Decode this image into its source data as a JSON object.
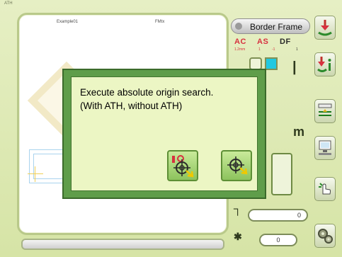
{
  "window": {
    "corner_tag": "ATH"
  },
  "canvas": {
    "title_left": "Example01",
    "title_right": "FMtx"
  },
  "right_panel": {
    "frame_button_label": "Border Frame",
    "code_labels": [
      "AC",
      "AS",
      "DF"
    ],
    "code_sub_labels": [
      "1.2mm",
      "1",
      "-1",
      "1"
    ],
    "letter_m": "m",
    "counter_1": "0",
    "counter_2": "0"
  },
  "dialog": {
    "message_line1": "Execute absolute origin search.",
    "message_line2": "(With ATH, without ATH)",
    "buttons": [
      {
        "name": "with-ath-origin-search-icon"
      },
      {
        "name": "without-ath-origin-search-icon"
      }
    ]
  },
  "colors": {
    "background": "#dde9b8",
    "dialog_frame": "#5f9d4a",
    "dialog_body": "#ecf6c4",
    "accent_red": "#d7313f",
    "accent_cyan": "#21c8e0"
  }
}
